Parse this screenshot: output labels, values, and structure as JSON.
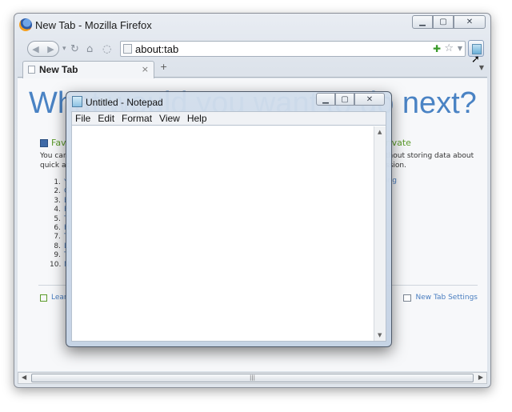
{
  "firefox": {
    "window_title": "New Tab - Mozilla Firefox",
    "url": "about:tab",
    "tab": {
      "label": "New Tab",
      "close": "×"
    },
    "new_tab_button": "+",
    "content": {
      "hero": "What would you want to do next?",
      "favorites_heading": "Fav",
      "favorites_desc": "You can\nquick ac",
      "favorites_list": [
        {
          "n": "1.",
          "t": "Y"
        },
        {
          "n": "2.",
          "t": "G"
        },
        {
          "n": "3.",
          "t": "B"
        },
        {
          "n": "4.",
          "t": "P"
        },
        {
          "n": "5.",
          "t": "T"
        },
        {
          "n": "6.",
          "t": "H"
        },
        {
          "n": "7.",
          "t": "T"
        },
        {
          "n": "8.",
          "t": "L"
        },
        {
          "n": "9.",
          "t": "T"
        },
        {
          "n": "10.",
          "t": "N"
        }
      ],
      "private_heading": "rivate",
      "private_desc": "thout storing data about\nssion.",
      "private_link": "ing",
      "learn_more": "Lear",
      "settings_link": "New Tab Settings"
    },
    "hscroll_grip": "|||"
  },
  "notepad": {
    "window_title": "Untitled - Notepad",
    "menu": [
      "File",
      "Edit",
      "Format",
      "View",
      "Help"
    ],
    "text": ""
  },
  "icons": {
    "back": "‹",
    "forward": "›",
    "reload": "C",
    "home": "⌂",
    "bookmark_star": "☆",
    "close": "✕",
    "minimize": "▭",
    "maximize": "▢"
  }
}
